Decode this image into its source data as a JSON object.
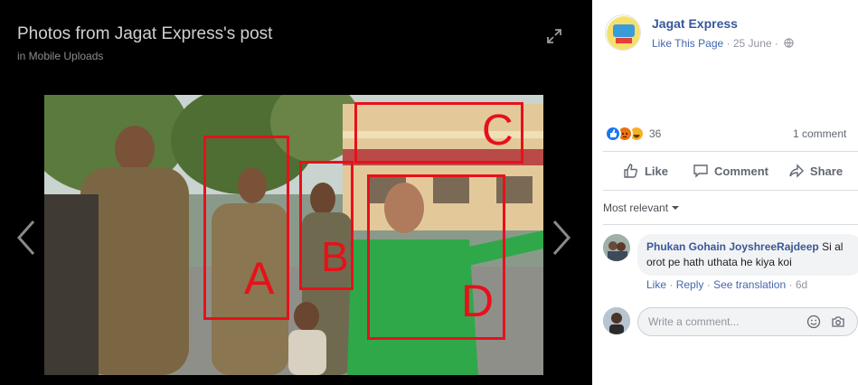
{
  "viewer": {
    "title": "Photos from Jagat Express's post",
    "subtitle": "in Mobile Uploads",
    "expand_icon": "expand-icon",
    "prev_icon": "chevron-left-icon",
    "next_icon": "chevron-right-icon"
  },
  "photo": {
    "boxes": [
      {
        "label": "A"
      },
      {
        "label": "B"
      },
      {
        "label": "C"
      },
      {
        "label": "D"
      }
    ],
    "box_color": "#e8101a"
  },
  "post": {
    "page_name": "Jagat Express",
    "like_page": "Like This Page",
    "separator": "·",
    "date": "25 June",
    "privacy_icon": "globe-icon"
  },
  "reactions": {
    "icons": [
      "like-icon",
      "angry-icon",
      "haha-icon"
    ],
    "count": "36",
    "comments": "1 comment"
  },
  "actions": [
    {
      "label": "Like",
      "icon": "thumbs-up-icon"
    },
    {
      "label": "Comment",
      "icon": "comment-icon"
    },
    {
      "label": "Share",
      "icon": "share-icon"
    }
  ],
  "filter": {
    "label": "Most relevant"
  },
  "comment": {
    "author": "Phukan Gohain JoyshreeRajdeep",
    "text": " Si al orot pe hath uthata he kiya koi",
    "like": "Like",
    "reply": "Reply",
    "see_translation": "See translation",
    "age": "6d"
  },
  "write_comment": {
    "placeholder": "Write a comment...",
    "emoji_icon": "emoji-icon",
    "camera_icon": "camera-icon"
  },
  "colors": {
    "link": "#365899",
    "fb_blue": "#4267b2",
    "like_blue": "#1877f2",
    "angry": "#e9710f",
    "haha": "#f7b125"
  }
}
